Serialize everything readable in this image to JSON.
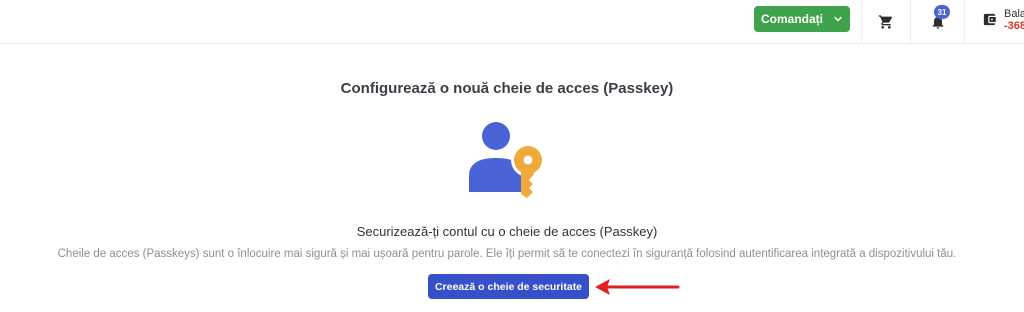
{
  "header": {
    "orders_label": "Comandați",
    "notifications_count": "31",
    "balance_label": "Bala",
    "balance_value": "-368"
  },
  "icons": {
    "chevron": "chevron-down-icon",
    "cart": "cart-icon",
    "bell": "bell-icon",
    "wallet": "wallet-icon",
    "illustration": "user-key-icon",
    "arrow": "arrow-left-icon"
  },
  "main": {
    "title": "Configurează o nouă cheie de acces (Passkey)",
    "subtitle": "Securizează-ți contul cu o cheie de acces (Passkey)",
    "description": "Cheile de acces (Passkeys) sunt o înlocuire mai sigură și mai ușoară pentru parole. Ele îți permit să te conectezi în siguranță folosind autentificarea integrată a dispozitivului tău.",
    "create_button": "Creează o cheie de securitate"
  },
  "colors": {
    "orders_green": "#3fa34d",
    "primary_blue": "#3550c8",
    "user_blue": "#4a64d8",
    "key_orange": "#f0a93b",
    "arrow_red": "#e02020",
    "negative_red": "#d9342b"
  }
}
